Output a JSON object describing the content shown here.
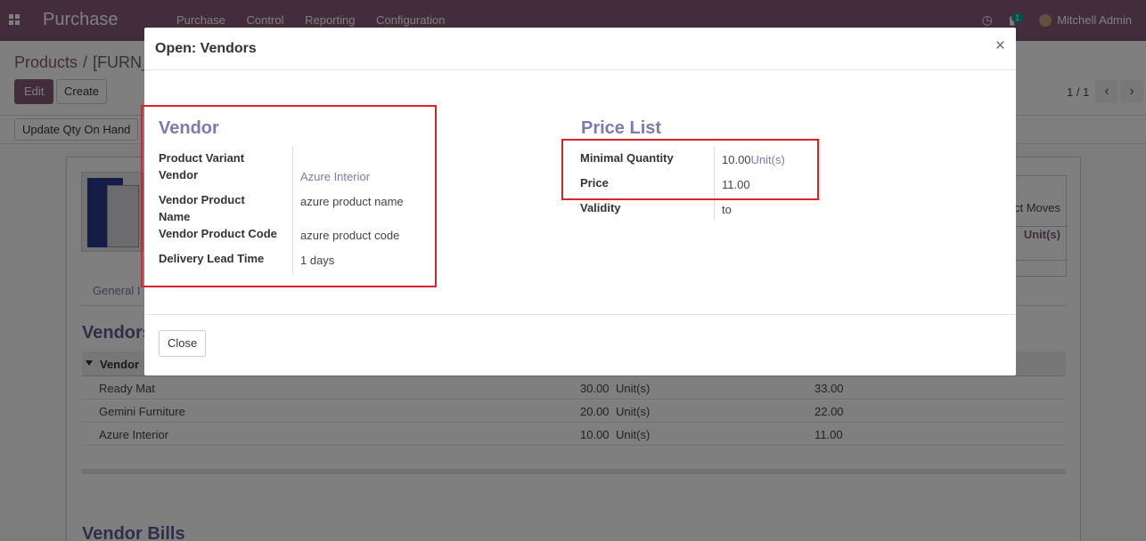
{
  "navbar": {
    "app_name": "Purchase",
    "menu": [
      "Purchase",
      "Control",
      "Reporting",
      "Configuration"
    ],
    "chat_count": "1",
    "user": "Mitchell Admin"
  },
  "control": {
    "breadcrumb_root": "Products",
    "breadcrumb_sep": "/",
    "breadcrumb_current": "[FURN_",
    "edit": "Edit",
    "create": "Create",
    "pager": "1 / 1",
    "prev": "‹",
    "next": "›",
    "update_qty": "Update Qty On Hand"
  },
  "sheet": {
    "smart_button_label": "ct Moves",
    "smart_button_value": "Unit(s)",
    "tab": "General I",
    "vendors_title": "Vendors",
    "list_header": "Vendor",
    "rows": [
      {
        "vendor": "Ready Mat",
        "qty": "30.00",
        "uom": "Unit(s)",
        "price": "33.00"
      },
      {
        "vendor": "Gemini Furniture",
        "qty": "20.00",
        "uom": "Unit(s)",
        "price": "22.00"
      },
      {
        "vendor": "Azure Interior",
        "qty": "10.00",
        "uom": "Unit(s)",
        "price": "11.00"
      }
    ],
    "bills_title": "Vendor Bills"
  },
  "modal": {
    "title": "Open: Vendors",
    "close_x": "×",
    "vendor_group": {
      "title": "Vendor",
      "product_variant_label": "Product Variant",
      "vendor_label": "Vendor",
      "vendor_value": "Azure Interior",
      "vendor_product_label_1": "Vendor Product",
      "vendor_product_label_2": "Name",
      "vendor_product_name": "azure product name",
      "vendor_code_label": "Vendor Product Code",
      "vendor_code_value": "azure product code",
      "lead_time_label": "Delivery Lead Time",
      "lead_time_value": "1 days"
    },
    "price_group": {
      "title": "Price List",
      "min_qty_label": "Minimal Quantity",
      "min_qty_value": "10.00",
      "min_qty_uom": "Unit(s)",
      "price_label": "Price",
      "price_value": "11.00",
      "validity_label": "Validity",
      "validity_value": "to"
    },
    "close_button": "Close"
  },
  "colors": {
    "brand": "#875a7b",
    "link": "#7c7bad",
    "highlight": "#d9232d"
  }
}
